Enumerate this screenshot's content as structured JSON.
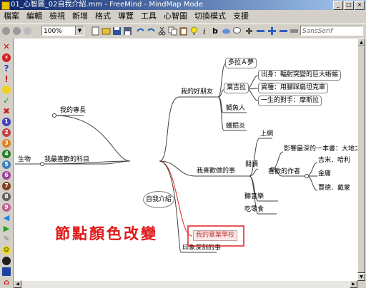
{
  "window": {
    "title": "01_心智圖_02自我介紹.mm - FreeMind - MindMap Mode",
    "min": "_",
    "max": "□",
    "close": "×"
  },
  "menu": [
    "檔案",
    "編輯",
    "檢視",
    "新增",
    "格式",
    "導覽",
    "工具",
    "心智圖",
    "切換模式",
    "支援"
  ],
  "toolbar": {
    "zoom": "100%",
    "font": "SansSerif",
    "bold": "b"
  },
  "mindmap": {
    "root": "自我介紹",
    "left": {
      "specialty": "我的專長",
      "subject": "我最喜歡的科目",
      "biology": "生物"
    },
    "friends": {
      "label": "我的好朋友",
      "a_dream": "多拉Ａ夢",
      "nobita": "葉吉拉",
      "nobita_children": [
        "出身：輻射突變的巨大蜥蜴",
        "異種：用腳踩扁坦克車",
        "一生的對手：摩斯拉"
      ],
      "others": [
        "鯛魚人",
        "蟻掘炎"
      ]
    },
    "likes": {
      "label": "我喜歡做的事",
      "internet": "上網",
      "reading": "閱讀",
      "book": "影響最深的一本書：大地之歌",
      "author": "喜歡的作者",
      "authors": [
        "吉米．哈利",
        "金庸",
        "賈德．戴蒙"
      ],
      "music": "聽音樂",
      "food": "吃零食"
    },
    "school": "我的畢業學校",
    "impression": "印象深刻的事"
  },
  "annotation": "節點顏色改變"
}
